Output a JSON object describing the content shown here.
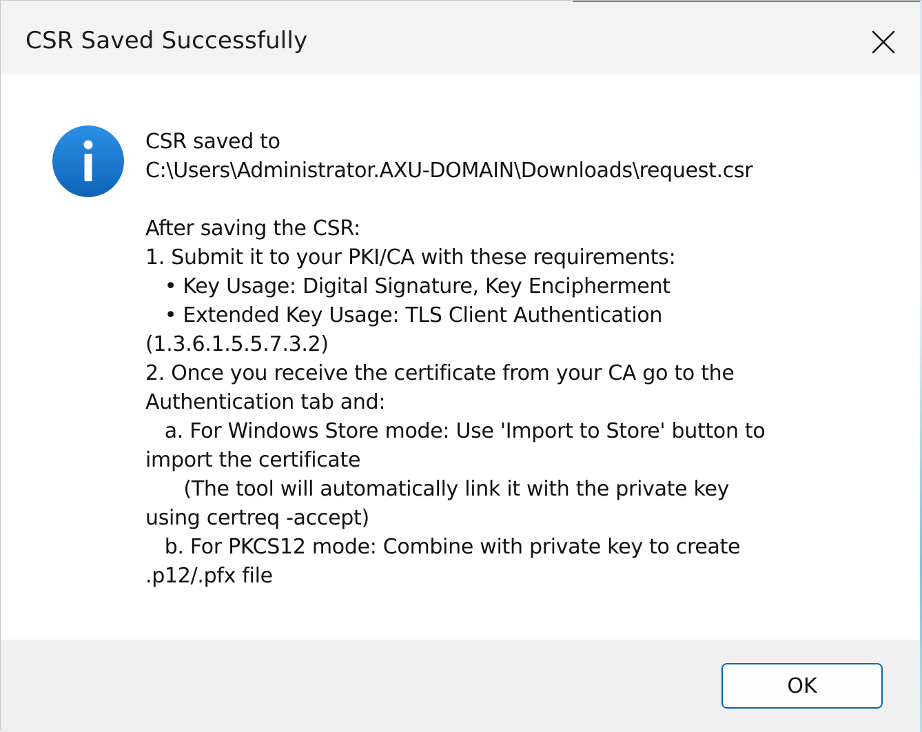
{
  "window": {
    "title": "CSR Saved Successfully",
    "close_icon": "close-icon"
  },
  "icon": {
    "name": "information-icon",
    "glyph": "i",
    "color": "#1f7fd6"
  },
  "message": {
    "lines": [
      "CSR saved to",
      "C:\\Users\\Administrator.AXU-DOMAIN\\Downloads\\request.csr",
      "",
      "After saving the CSR:",
      "1. Submit it to your PKI/CA with these requirements:",
      "   • Key Usage: Digital Signature, Key Encipherment",
      "   • Extended Key Usage: TLS Client Authentication",
      "(1.3.6.1.5.5.7.3.2)",
      "2. Once you receive the certificate from your CA go to the",
      "Authentication tab and:",
      "   a. For Windows Store mode: Use 'Import to Store' button to",
      "import the certificate",
      "      (The tool will automatically link it with the private key",
      "using certreq -accept)",
      "   b. For PKCS12 mode: Combine with private key to create",
      ".p12/.pfx file"
    ]
  },
  "buttons": {
    "ok_label": "OK"
  },
  "colors": {
    "accent": "#0067c0",
    "titlebar": "#f3f3f3",
    "footer": "#f0f0f0"
  }
}
